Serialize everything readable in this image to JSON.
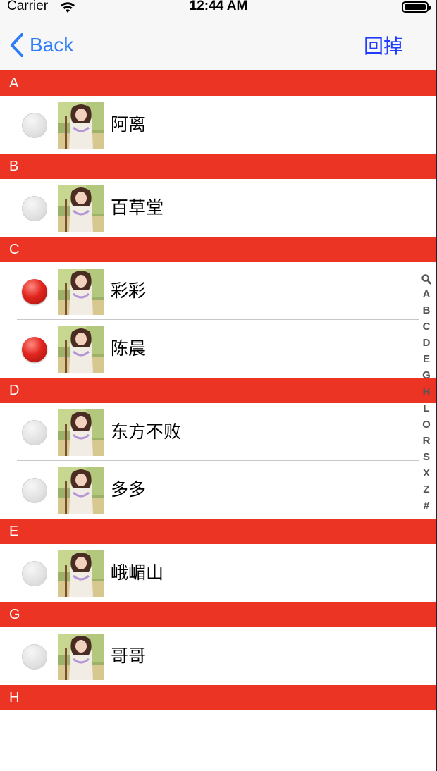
{
  "status_bar": {
    "carrier": "Carrier",
    "time": "12:44 AM"
  },
  "nav": {
    "back_label": "Back",
    "right_button": "回掉"
  },
  "sections": [
    {
      "letter": "A",
      "rows": [
        {
          "name": "阿离",
          "selected": false
        }
      ]
    },
    {
      "letter": "B",
      "rows": [
        {
          "name": "百草堂",
          "selected": false
        }
      ]
    },
    {
      "letter": "C",
      "rows": [
        {
          "name": "彩彩",
          "selected": true
        },
        {
          "name": "陈晨",
          "selected": true
        }
      ]
    },
    {
      "letter": "D",
      "rows": [
        {
          "name": "东方不败",
          "selected": false
        },
        {
          "name": "多多",
          "selected": false
        }
      ]
    },
    {
      "letter": "E",
      "rows": [
        {
          "name": "峨嵋山",
          "selected": false
        }
      ]
    },
    {
      "letter": "G",
      "rows": [
        {
          "name": "哥哥",
          "selected": false
        }
      ]
    },
    {
      "letter": "H",
      "rows": []
    }
  ],
  "index_letters": [
    "A",
    "B",
    "C",
    "D",
    "E",
    "G",
    "H",
    "L",
    "O",
    "R",
    "S",
    "X",
    "Z",
    "#"
  ],
  "colors": {
    "section_header": "#ec3424",
    "accent": "#2e7cf6",
    "right_button": "#1f3cff"
  }
}
